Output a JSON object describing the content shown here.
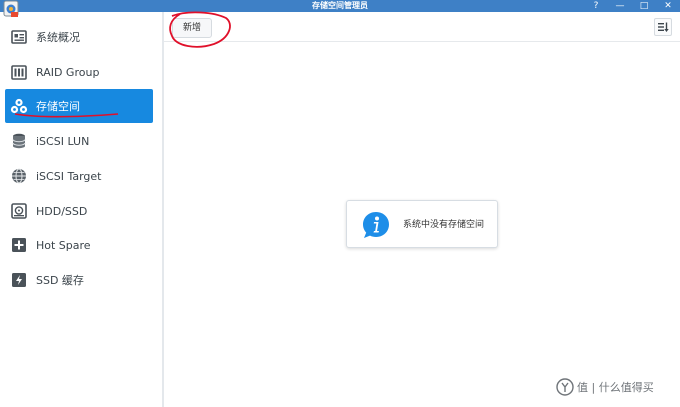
{
  "window": {
    "title": "存储空间管理员",
    "controls": [
      "?",
      "—",
      "□",
      "✕"
    ]
  },
  "sidebar": {
    "items": [
      {
        "label": "系统概况",
        "icon": "overview-icon",
        "active": false
      },
      {
        "label": "RAID Group",
        "icon": "raid-group-icon",
        "active": false
      },
      {
        "label": "存储空间",
        "icon": "storage-volume-icon",
        "active": true
      },
      {
        "label": "iSCSI LUN",
        "icon": "iscsi-lun-icon",
        "active": false
      },
      {
        "label": "iSCSI Target",
        "icon": "iscsi-target-icon",
        "active": false
      },
      {
        "label": "HDD/SSD",
        "icon": "hdd-ssd-icon",
        "active": false
      },
      {
        "label": "Hot Spare",
        "icon": "hot-spare-icon",
        "active": false
      },
      {
        "label": "SSD 缓存",
        "icon": "ssd-cache-icon",
        "active": false
      }
    ]
  },
  "toolbar": {
    "new_label": "新增",
    "sort_icon": "sort-icon"
  },
  "main": {
    "empty_message": "系统中没有存储空间",
    "info_icon": "info-icon"
  },
  "watermark": {
    "text": "值 | 什么值得买"
  },
  "colors": {
    "titlebar": "#3e80c6",
    "active": "#1789e0",
    "annotation": "#e0102a"
  }
}
